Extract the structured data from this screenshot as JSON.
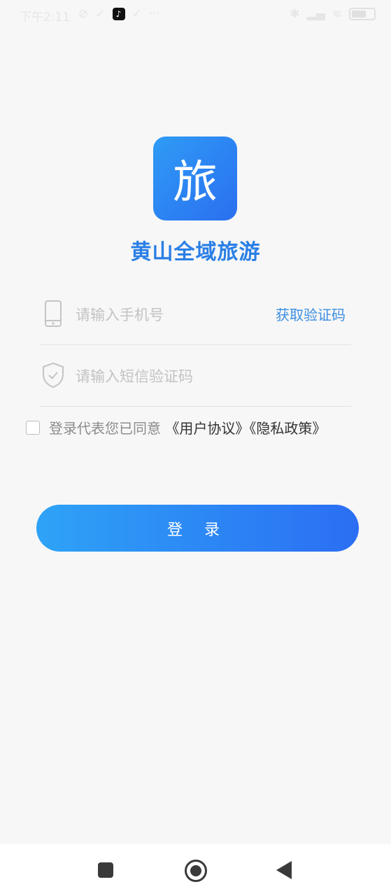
{
  "status_bar": {
    "time": "下午2:11",
    "dots": "···",
    "left_icons": [
      "sync-off-icon",
      "check-icon",
      "tiktok-icon",
      "check-icon"
    ],
    "right_icons": [
      "bluetooth-icon",
      "signal-icon",
      "wifi-icon",
      "battery-icon"
    ]
  },
  "logo": {
    "glyph": "旅"
  },
  "app_title": "黄山全域旅游",
  "phone_field": {
    "placeholder": "请输入手机号",
    "icon": "phone-icon"
  },
  "get_code_label": "获取验证码",
  "code_field": {
    "placeholder": "请输入短信验证码",
    "icon": "shield-check-icon"
  },
  "agreement": {
    "prefix": "登录代表您已同意",
    "user_agreement": "《用户协议》",
    "privacy_policy": "《隐私政策》",
    "checked": false
  },
  "login_label": "登 录",
  "nav_bar": {
    "items": [
      "recent-apps-icon",
      "home-icon",
      "back-icon"
    ]
  },
  "colors": {
    "accent": "#2a7fe6",
    "link": "#3b8ee0",
    "button_start": "#2ea3f6",
    "button_end": "#2b6ef3"
  }
}
